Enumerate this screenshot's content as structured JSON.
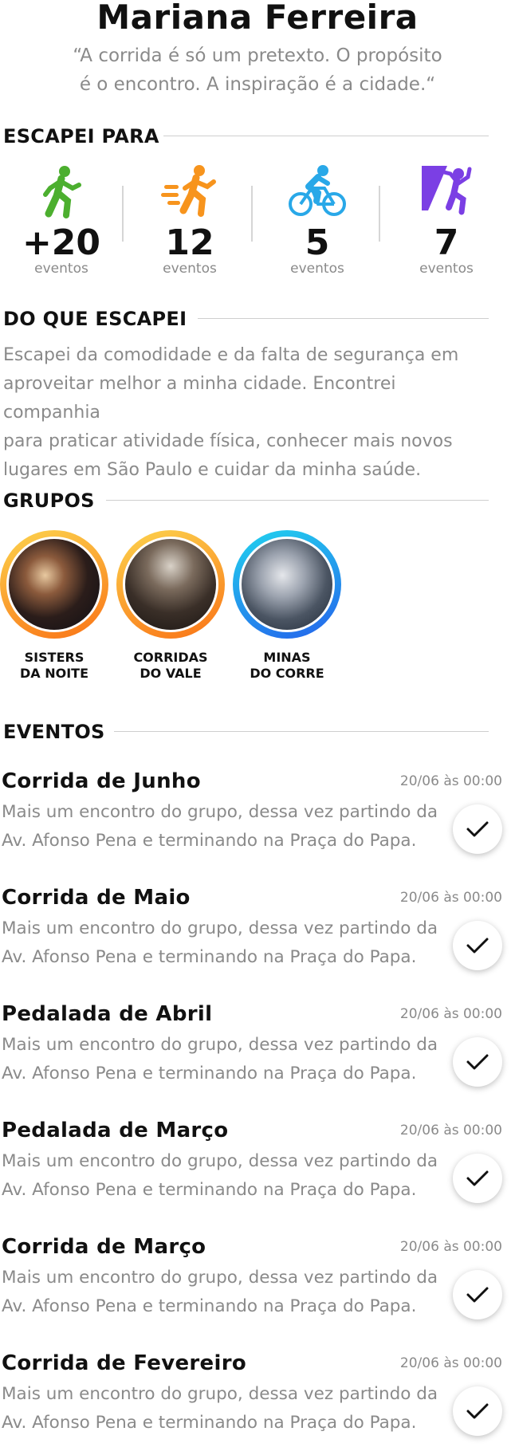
{
  "profile": {
    "name": "Mariana Ferreira",
    "quote_line1": "“A corrida é só um pretexto. O propósito",
    "quote_line2": "é o encontro. A inspiração é a cidade.“"
  },
  "escapei_para": {
    "title": "ESCAPEI PARA",
    "stats": [
      {
        "icon": "running-person-icon",
        "color": "#4caf2f",
        "value": "+20",
        "label": "eventos"
      },
      {
        "icon": "sprinting-person-icon",
        "color": "#f7941d",
        "value": "12",
        "label": "eventos"
      },
      {
        "icon": "cyclist-icon",
        "color": "#29a8e8",
        "value": "5",
        "label": "eventos"
      },
      {
        "icon": "climber-icon",
        "color": "#7b3fe4",
        "value": "7",
        "label": "eventos"
      }
    ]
  },
  "do_que_escapei": {
    "title": "DO QUE ESCAPEI",
    "lines": [
      "Escapei da comodidade e da falta de segurança em",
      "aproveitar melhor a minha cidade. Encontrei companhia",
      "para praticar atividade física, conhecer mais novos",
      "lugares em São Paulo e cuidar da minha saúde."
    ]
  },
  "grupos": {
    "title": "GRUPOS",
    "items": [
      {
        "line1": "SISTERS",
        "line2": "DA NOITE",
        "ring": "orange-gradient"
      },
      {
        "line1": "CORRIDAS",
        "line2": "DO VALE",
        "ring": "orange-gradient"
      },
      {
        "line1": "MINAS",
        "line2": "DO CORRE",
        "ring": "blue-gradient"
      }
    ]
  },
  "eventos": {
    "title": "EVENTOS",
    "items": [
      {
        "title": "Corrida de Junho",
        "date": "20/06 às 00:00",
        "desc1": "Mais um encontro do grupo, dessa vez partindo da",
        "desc2": "Av. Afonso Pena e terminando na Praça do Papa."
      },
      {
        "title": "Corrida de Maio",
        "date": "20/06 às 00:00",
        "desc1": "Mais um encontro do grupo, dessa vez partindo da",
        "desc2": "Av. Afonso Pena e terminando na Praça do Papa."
      },
      {
        "title": "Pedalada de Abril",
        "date": "20/06 às 00:00",
        "desc1": "Mais um encontro do grupo, dessa vez partindo da",
        "desc2": "Av. Afonso Pena e terminando na Praça do Papa."
      },
      {
        "title": "Pedalada de Março",
        "date": "20/06 às 00:00",
        "desc1": "Mais um encontro do grupo, dessa vez partindo da",
        "desc2": "Av. Afonso Pena e terminando na Praça do Papa."
      },
      {
        "title": "Corrida de Março",
        "date": "20/06 às 00:00",
        "desc1": "Mais um encontro do grupo, dessa vez partindo da",
        "desc2": "Av. Afonso Pena e terminando na Praça do Papa."
      },
      {
        "title": "Corrida de Fevereiro",
        "date": "20/06 às 00:00",
        "desc1": "Mais um encontro do grupo, dessa vez partindo da",
        "desc2": "Av. Afonso Pena e terminando na Praça do Papa."
      }
    ]
  },
  "colors": {
    "text": "#111111",
    "muted": "#8a8a8a",
    "orange_ring": "#f7941d",
    "blue_ring": "#2a7de1"
  }
}
